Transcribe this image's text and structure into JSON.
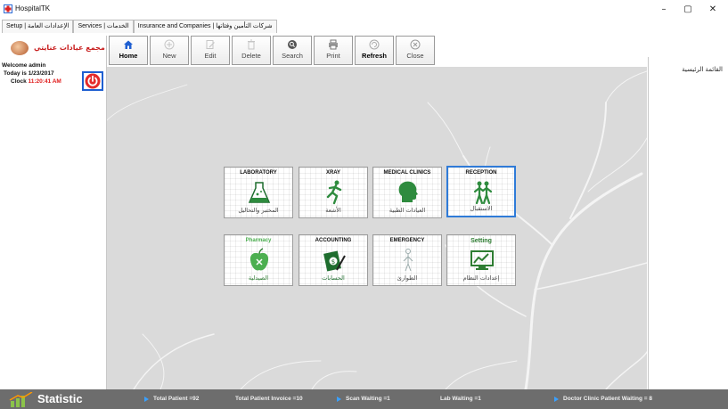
{
  "window": {
    "title": "HospitalTK",
    "minimize": "–",
    "maximize": "▢",
    "close": "✕"
  },
  "menu": [
    "Setup | الإعدادات العامة",
    "Services | الخدمات",
    "Insurance and Companies | شركات التأمين وفئاتها"
  ],
  "left_panel": {
    "clinic_name": "مجمع عيادات عنايتي",
    "welcome": "Welcome admin",
    "today": "Today is  1/23/2017",
    "clock_label": "Clock",
    "clock_value": "11:20:41 AM"
  },
  "toolbar": {
    "home": "Home",
    "new": "New",
    "edit": "Edit",
    "delete": "Delete",
    "search": "Search",
    "print": "Print",
    "refresh": "Refresh",
    "close": "Close"
  },
  "modules": [
    {
      "title": "LABORATORY",
      "arabic": "المختبر والتحاليل",
      "color": "#1c1c1c"
    },
    {
      "title": "XRAY",
      "arabic": "الأشعة",
      "color": "#1c1c1c"
    },
    {
      "title": "MEDICAL CLINICS",
      "arabic": "العيادات الطبية",
      "color": "#1c1c1c"
    },
    {
      "title": "RECEPTION",
      "arabic": "الاستقبال",
      "color": "#1e7d32"
    },
    {
      "title": "Pharmacy",
      "arabic": "الصيدلية",
      "color": "#4caf50"
    },
    {
      "title": "ACCOUNTING",
      "arabic": "الحسابات",
      "color": "#1c1c1c"
    },
    {
      "title": "EMERGENCY",
      "arabic": "الطوارئ",
      "color": "#1c1c1c"
    },
    {
      "title": "Setting",
      "arabic": "إعدادات النظام",
      "color": "#2e7d32"
    }
  ],
  "right_panel": {
    "title": "القائمة الرئيسية"
  },
  "status": {
    "label": "Statistic",
    "total_patient": "Total Patient =92",
    "total_invoice": "Total Patient Invoice =10",
    "scan_waiting": "Scan  Waiting  =1",
    "lab_waiting": "Lab Waiting =1",
    "doctor_waiting": "Doctor Clinic Patient Waiting = 8"
  },
  "colors": {
    "accent_blue": "#2f7bd8",
    "clock_red": "#e01b1b",
    "status_bar": "#6d6d6d"
  }
}
